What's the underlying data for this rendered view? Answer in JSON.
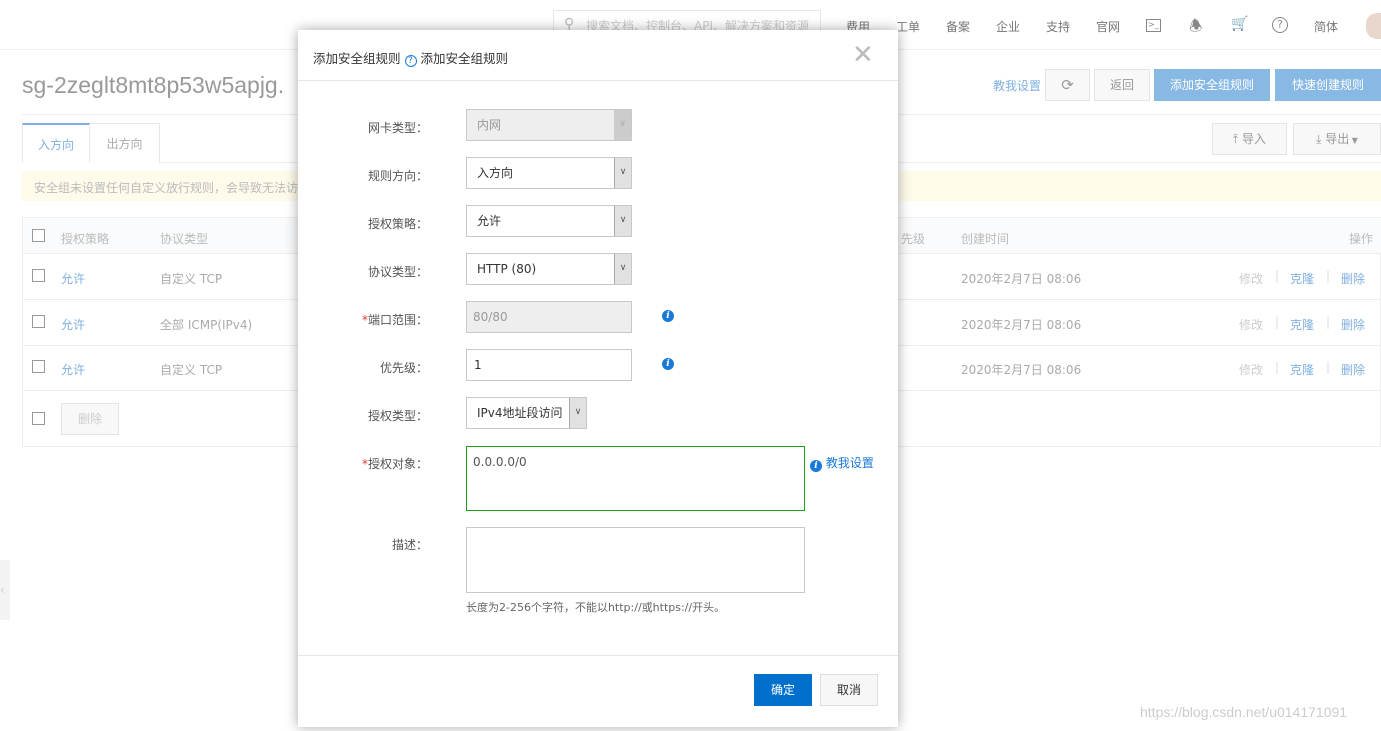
{
  "nav": {
    "search_placeholder": "搜索文档、控制台、API、解决方案和资源",
    "items": [
      "费用",
      "工单",
      "备案",
      "企业",
      "支持",
      "官网"
    ],
    "lang": "简体",
    "icons": [
      "terminal-icon",
      "bell-icon",
      "cart-icon",
      "help-icon"
    ]
  },
  "page": {
    "title": "sg-2zeglt8mt8p53w5apjg.",
    "help_link": "教我设置",
    "back": "返回",
    "add_rule": "添加安全组规则",
    "quick_create": "快速创建规则",
    "tabs": [
      "入方向",
      "出方向"
    ],
    "import": "导入",
    "export": "导出",
    "warning": "安全组未设置任何自定义放行规则，会导致无法访",
    "table": {
      "headers": [
        "授权策略",
        "协议类型",
        "先级",
        "创建时间",
        "操作"
      ],
      "rows": [
        {
          "policy": "允许",
          "protocol": "自定义 TCP",
          "created": "2020年2月7日 08:06"
        },
        {
          "policy": "允许",
          "protocol": "全部 ICMP(IPv4)",
          "created": "2020年2月7日 08:06"
        },
        {
          "policy": "允许",
          "protocol": "自定义 TCP",
          "created": "2020年2月7日 08:06"
        }
      ],
      "actions": [
        "修改",
        "克隆",
        "删除"
      ],
      "bulk_delete": "删除"
    }
  },
  "dialog": {
    "title": "添加安全组规则",
    "help_title": "添加安全组规则",
    "fields": {
      "nic_label": "网卡类型：",
      "nic": "内网",
      "direction_label": "规则方向：",
      "direction": "入方向",
      "policy_label": "授权策略：",
      "policy": "允许",
      "protocol_label": "协议类型：",
      "protocol": "HTTP (80)",
      "port_label": "端口范围：",
      "port": "80/80",
      "priority_label": "优先级：",
      "priority": "1",
      "authtype_label": "授权类型：",
      "authtype": "IPv4地址段访问",
      "target_label": "授权对象：",
      "target": "0.0.0.0/0",
      "target_help": "教我设置",
      "desc_label": "描述：",
      "desc": "",
      "desc_hint": "长度为2-256个字符，不能以http://或https://开头。"
    },
    "ok": "确定",
    "cancel": "取消"
  },
  "watermark": "https://blog.csdn.net/u014171091",
  "colors": {
    "primary": "#0070cc",
    "focus_border": "#1aa01a",
    "light_primary": "#88b8e4"
  }
}
